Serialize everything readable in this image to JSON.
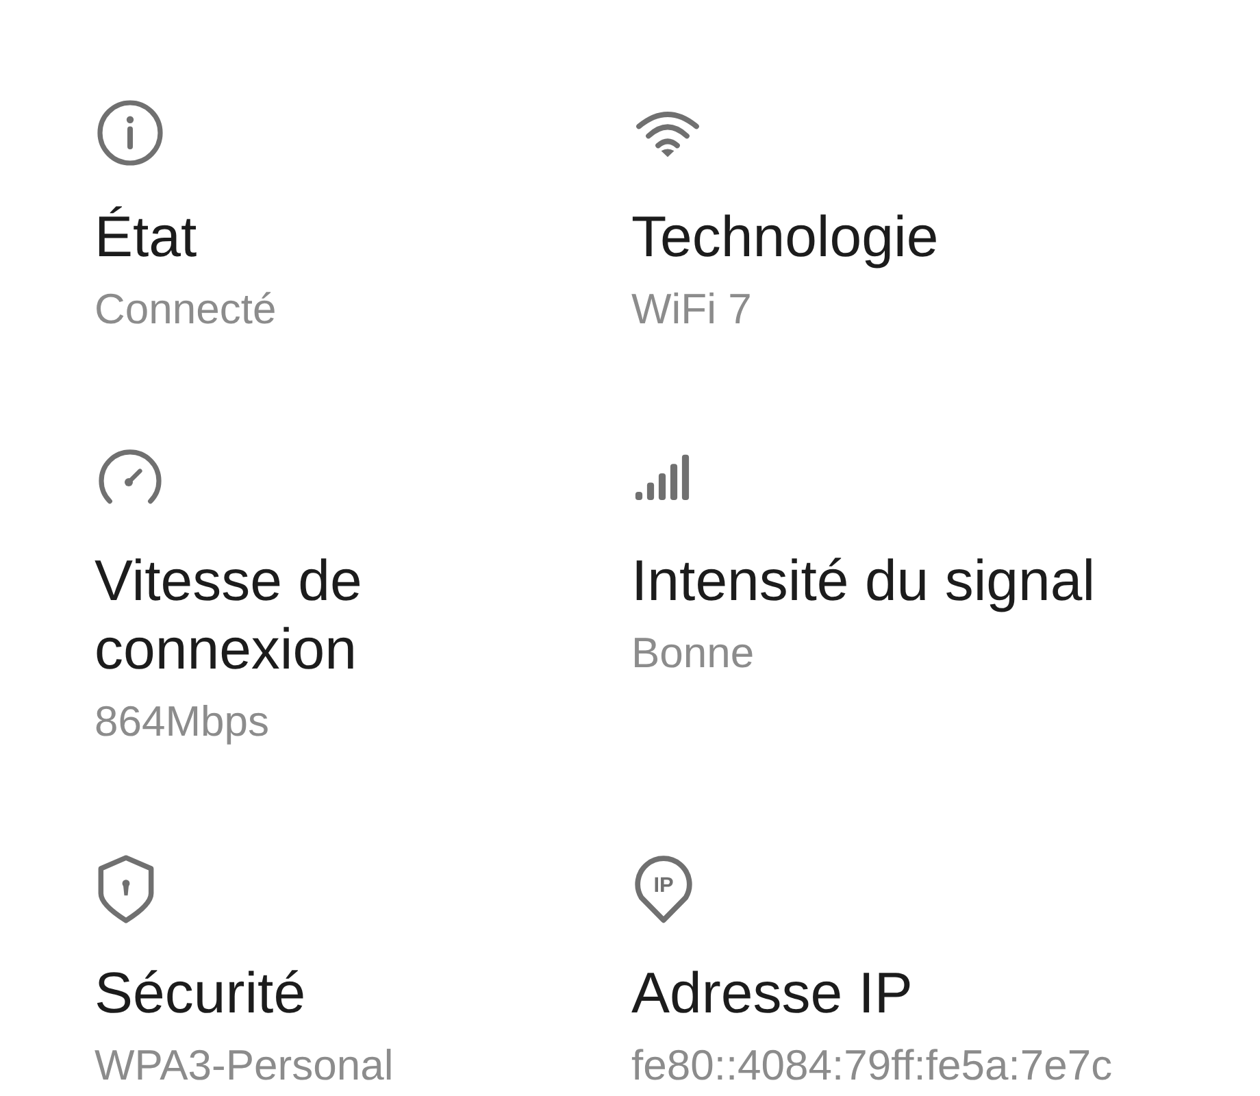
{
  "rows": [
    {
      "cells": [
        {
          "kind": "info",
          "title": "État",
          "value": "Connecté"
        },
        {
          "kind": "wifi",
          "title": "Technologie",
          "value": "WiFi 7"
        }
      ]
    },
    {
      "cells": [
        {
          "kind": "speedometer",
          "title": "Vitesse de connexion",
          "value": "864Mbps"
        },
        {
          "kind": "signal",
          "title": "Intensité du signal",
          "value": "Bonne"
        }
      ]
    },
    {
      "cells": [
        {
          "kind": "shield",
          "title": "Sécurité",
          "value": "WPA3-Personal"
        },
        {
          "kind": "pin",
          "icon_label": "IP",
          "title": "Adresse IP",
          "value": "fe80::4084:79ff:fe5a:7e7c"
        }
      ]
    }
  ]
}
